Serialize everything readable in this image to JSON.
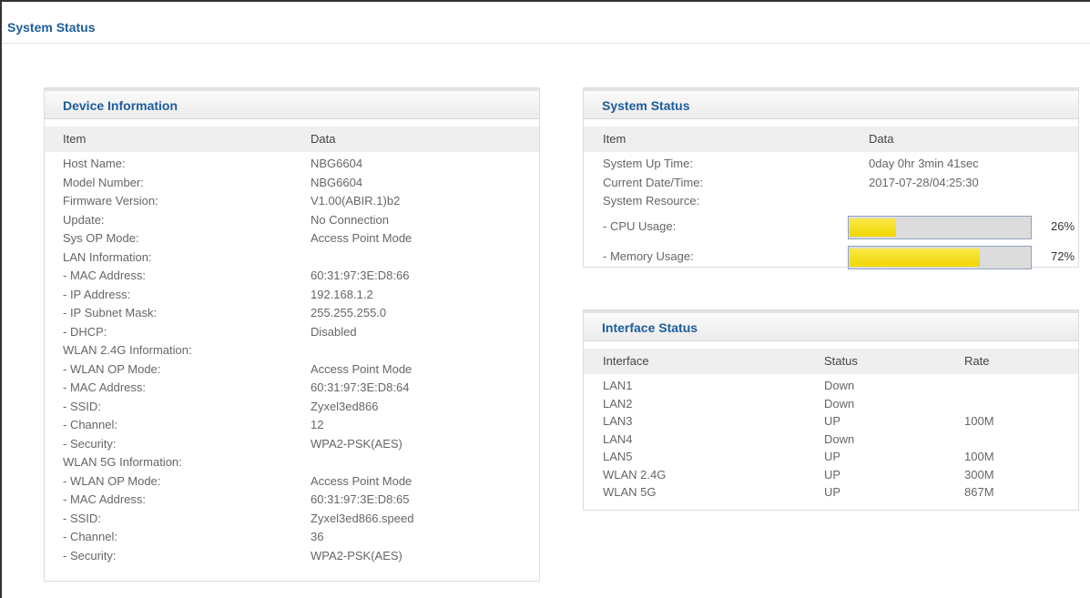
{
  "page_title": "System Status",
  "device_info": {
    "title": "Device Information",
    "col_item": "Item",
    "col_data": "Data",
    "rows": [
      {
        "item": "Host Name:",
        "data": "NBG6604"
      },
      {
        "item": "Model Number:",
        "data": "NBG6604"
      },
      {
        "item": "Firmware Version:",
        "data": "V1.00(ABIR.1)b2"
      },
      {
        "item": "Update:",
        "data": "No Connection"
      },
      {
        "item": "Sys OP Mode:",
        "data": "Access Point Mode"
      },
      {
        "item": "LAN Information:",
        "data": ""
      },
      {
        "item": "- MAC Address:",
        "data": "60:31:97:3E:D8:66"
      },
      {
        "item": "- IP Address:",
        "data": "192.168.1.2"
      },
      {
        "item": "- IP Subnet Mask:",
        "data": "255.255.255.0"
      },
      {
        "item": "- DHCP:",
        "data": "Disabled"
      },
      {
        "item": "WLAN 2.4G Information:",
        "data": ""
      },
      {
        "item": "- WLAN OP Mode:",
        "data": "Access Point Mode"
      },
      {
        "item": "- MAC Address:",
        "data": "60:31:97:3E:D8:64"
      },
      {
        "item": "- SSID:",
        "data": "Zyxel3ed866"
      },
      {
        "item": "- Channel:",
        "data": "12"
      },
      {
        "item": "- Security:",
        "data": "WPA2-PSK(AES)"
      },
      {
        "item": "WLAN 5G Information:",
        "data": ""
      },
      {
        "item": "- WLAN OP Mode:",
        "data": "Access Point Mode"
      },
      {
        "item": "- MAC Address:",
        "data": "60:31:97:3E:D8:65"
      },
      {
        "item": "- SSID:",
        "data": "Zyxel3ed866.speed"
      },
      {
        "item": "- Channel:",
        "data": "36"
      },
      {
        "item": "- Security:",
        "data": "WPA2-PSK(AES)"
      }
    ]
  },
  "system_status": {
    "title": "System Status",
    "col_item": "Item",
    "col_data": "Data",
    "up_time_label": "System Up Time:",
    "up_time": "0day 0hr 3min 41sec",
    "date_label": "Current Date/Time:",
    "date": "2017-07-28/04:25:30",
    "resource_label": "System Resource:",
    "cpu_label": "- CPU Usage:",
    "cpu_percent": 26,
    "cpu_text": "26%",
    "mem_label": "- Memory Usage:",
    "mem_percent": 72,
    "mem_text": "72%",
    "bar_color": "#f5e000"
  },
  "interface_status": {
    "title": "Interface Status",
    "col_interface": "Interface",
    "col_status": "Status",
    "col_rate": "Rate",
    "rows": [
      {
        "name": "LAN1",
        "status": "Down",
        "rate": ""
      },
      {
        "name": "LAN2",
        "status": "Down",
        "rate": ""
      },
      {
        "name": "LAN3",
        "status": "UP",
        "rate": "100M"
      },
      {
        "name": "LAN4",
        "status": "Down",
        "rate": ""
      },
      {
        "name": "LAN5",
        "status": "UP",
        "rate": "100M"
      },
      {
        "name": "WLAN 2.4G",
        "status": "UP",
        "rate": "300M"
      },
      {
        "name": "WLAN 5G",
        "status": "UP",
        "rate": "867M"
      }
    ]
  }
}
